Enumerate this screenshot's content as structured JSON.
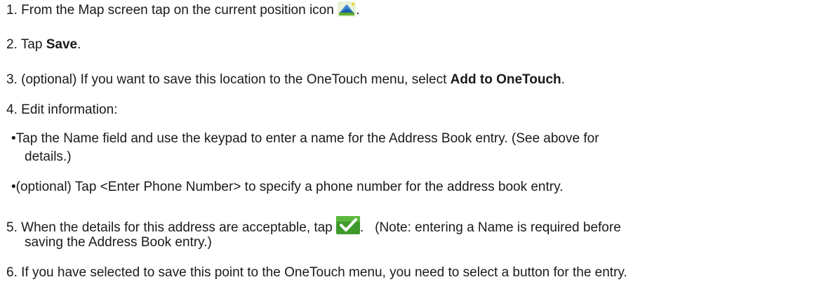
{
  "steps": [
    {
      "num": "1.",
      "pre": "From the Map screen tap on the current position icon",
      "icon": "current-position-icon",
      "post": "."
    },
    {
      "num": "2.",
      "pre": "Tap ",
      "bold": "Save",
      "post": "."
    },
    {
      "num": "3.",
      "pre": "(optional) If you want to save this location to the OneTouch menu, select ",
      "bold": "Add to OneTouch",
      "post": "."
    },
    {
      "num": "4.",
      "text": "Edit information:"
    },
    {
      "bullets": [
        {
          "line1": "•Tap the Name field and use the keypad to enter a name for the Address Book entry. (See above for",
          "line2": "details.)"
        },
        {
          "line1": "•(optional) Tap <Enter Phone Number> to specify a phone number for the address book entry."
        }
      ]
    },
    {
      "num": "5.",
      "pre": "When the details for this address are acceptable, tap",
      "icon": "green-checkmark-icon",
      "post": ".   (Note: entering a Name is required before",
      "line2": "saving the Address Book entry.)"
    },
    {
      "num": "6.",
      "text": "If you have selected to save this point to the OneTouch menu, you need to select a button for the entry."
    }
  ],
  "colors": {
    "text": "#1a1a1a",
    "position_icon_blue": "#3b86d6",
    "position_icon_green": "#5fae2e",
    "check_bg": "#3f9a2c",
    "check_mark": "#ffffff"
  }
}
